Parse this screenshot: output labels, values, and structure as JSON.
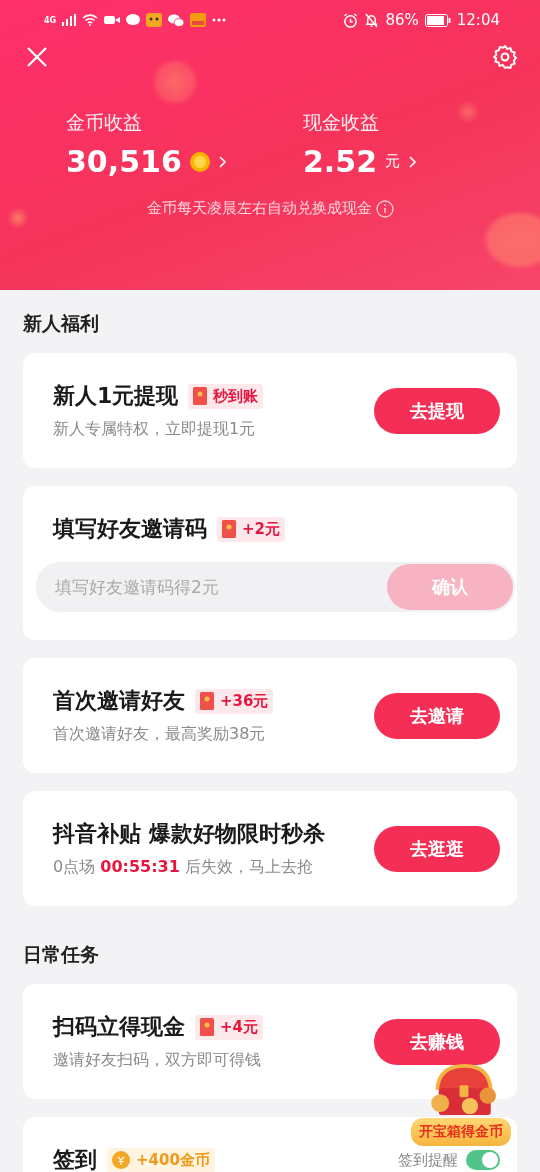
{
  "status_bar": {
    "network": "4G",
    "battery": "86%",
    "time": "12:04"
  },
  "header": {
    "stats": [
      {
        "label": "金币收益",
        "value": "30,516",
        "kind": "coin"
      },
      {
        "label": "现金收益",
        "value": "2.52",
        "unit": "元",
        "kind": "cash"
      }
    ],
    "note": "金币每天凌晨左右自动兑换成现金"
  },
  "sections": [
    {
      "title": "新人福利",
      "tasks": [
        {
          "kind": "button",
          "title": "新人1元提现",
          "badge": {
            "kind": "redpacket",
            "text": "秒到账"
          },
          "subtitle": "新人专属特权，立即提现1元",
          "button": "去提现"
        },
        {
          "kind": "input",
          "title": "填写好友邀请码",
          "badge": {
            "kind": "redpacket",
            "text": "+2元"
          },
          "placeholder": "填写好友邀请码得2元",
          "button": "确认",
          "disabled": true
        },
        {
          "kind": "button",
          "title": "首次邀请好友",
          "badge": {
            "kind": "redpacket",
            "text": "+36元"
          },
          "subtitle": "首次邀请好友，最高奖励38元",
          "button": "去邀请"
        },
        {
          "kind": "button",
          "title": "抖音补贴 爆款好物限时秒杀",
          "subtitle": "0点场 **00:55:31** 后失效，马上去抢",
          "button": "去逛逛"
        }
      ]
    },
    {
      "title": "日常任务",
      "tasks": [
        {
          "kind": "button",
          "title": "扫码立得现金",
          "badge": {
            "kind": "redpacket",
            "text": "+4元"
          },
          "subtitle": "邀请好友扫码，双方即可得钱",
          "button": "去赚钱"
        },
        {
          "kind": "toggle",
          "title": "签到",
          "badge": {
            "kind": "coin",
            "text": "+400金币"
          },
          "toggle_label": "签到提醒",
          "on": true
        }
      ]
    }
  ],
  "floating": {
    "label": "开宝箱得金币"
  }
}
